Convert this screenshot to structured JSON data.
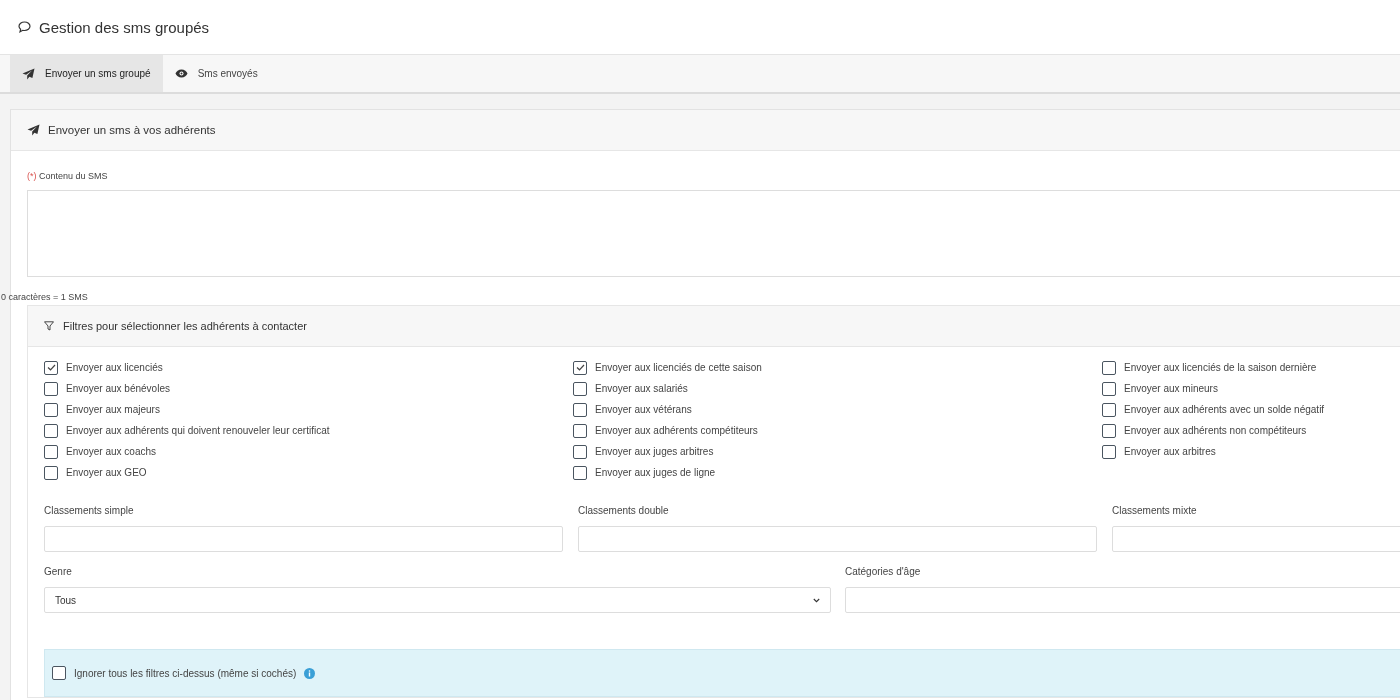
{
  "page": {
    "title": "Gestion des sms groupés"
  },
  "tabs": [
    {
      "label": "Envoyer un sms groupé",
      "selected": true
    },
    {
      "label": "Sms envoyés",
      "selected": false
    }
  ],
  "card": {
    "title": "Envoyer un sms à vos adhérents",
    "message": {
      "required_mark": "(*)",
      "label": "Contenu du SMS"
    },
    "counter": "0 caractères = 1 SMS",
    "filters": {
      "title": "Filtres pour sélectionner les adhérents à contacter",
      "columns": [
        [
          {
            "label": "Envoyer aux licenciés",
            "checked": true
          },
          {
            "label": "Envoyer aux bénévoles",
            "checked": false
          },
          {
            "label": "Envoyer aux majeurs",
            "checked": false
          },
          {
            "label": "Envoyer aux adhérents qui doivent renouveler leur certificat",
            "checked": false
          },
          {
            "label": "Envoyer aux coachs",
            "checked": false
          },
          {
            "label": "Envoyer aux GEO",
            "checked": false
          }
        ],
        [
          {
            "label": "Envoyer aux licenciés de cette saison",
            "checked": true
          },
          {
            "label": "Envoyer aux salariés",
            "checked": false
          },
          {
            "label": "Envoyer aux vétérans",
            "checked": false
          },
          {
            "label": "Envoyer aux adhérents compétiteurs",
            "checked": false
          },
          {
            "label": "Envoyer aux juges arbitres",
            "checked": false
          },
          {
            "label": "Envoyer aux juges de ligne",
            "checked": false
          }
        ],
        [
          {
            "label": "Envoyer aux licenciés de la saison dernière",
            "checked": false
          },
          {
            "label": "Envoyer aux mineurs",
            "checked": false
          },
          {
            "label": "Envoyer aux adhérents avec un solde négatif",
            "checked": false
          },
          {
            "label": "Envoyer aux adhérents non compétiteurs",
            "checked": false
          },
          {
            "label": "Envoyer aux arbitres",
            "checked": false
          }
        ]
      ],
      "rankings": [
        {
          "label": "Classements simple",
          "kind": "input"
        },
        {
          "label": "Classements double",
          "kind": "input"
        },
        {
          "label": "Classements mixte",
          "kind": "input"
        }
      ],
      "selectors": [
        {
          "label": "Genre",
          "kind": "select",
          "value": "Tous"
        },
        {
          "label": "Catégories d'âge",
          "kind": "input"
        }
      ],
      "ignore": {
        "label": "Ignorer tous les filtres ci-dessus (même si cochés)",
        "checked": false
      }
    }
  }
}
